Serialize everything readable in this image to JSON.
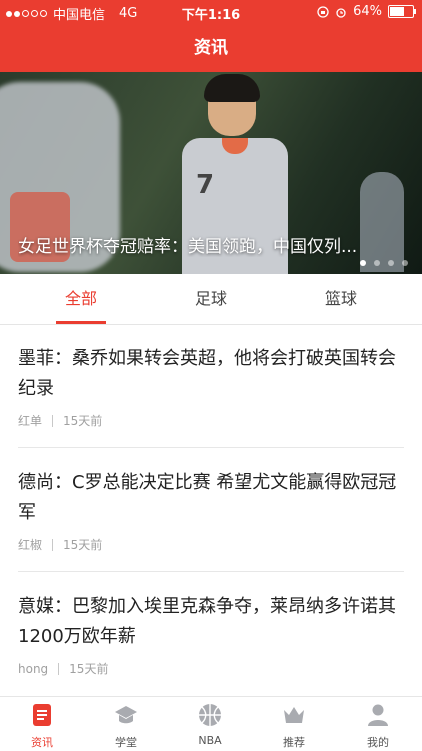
{
  "status_bar": {
    "carrier": "中国电信",
    "network": "4G",
    "time": "下午1:16",
    "battery": "64%"
  },
  "nav": {
    "title": "资讯"
  },
  "banner": {
    "caption": "女足世界杯夺冠赔率：美国领跑，中国仅列...",
    "jersey_number": "7",
    "page_count": 4,
    "active_page": 1
  },
  "tabs": [
    {
      "label": "全部",
      "active": true
    },
    {
      "label": "足球",
      "active": false
    },
    {
      "label": "篮球",
      "active": false
    }
  ],
  "news": [
    {
      "title": "墨菲：桑乔如果转会英超，他将会打破英国转会纪录",
      "source": "红单",
      "time": "15天前"
    },
    {
      "title": "德尚：C罗总能决定比赛 希望尤文能赢得欧冠冠军",
      "source": "红椒",
      "time": "15天前"
    },
    {
      "title": "意媒：巴黎加入埃里克森争夺，莱昂纳多许诺其1200万欧年薪",
      "source": "hong",
      "time": "15天前"
    }
  ],
  "tabbar": [
    {
      "label": "资讯",
      "icon": "news-icon",
      "active": true
    },
    {
      "label": "学堂",
      "icon": "graduation-cap-icon",
      "active": false
    },
    {
      "label": "NBA",
      "icon": "basketball-icon",
      "active": false
    },
    {
      "label": "推荐",
      "icon": "crown-icon",
      "active": false
    },
    {
      "label": "我的",
      "icon": "user-icon",
      "active": false
    }
  ],
  "colors": {
    "accent": "#ea3d30",
    "tab_text": "#444444",
    "meta_text": "#a0a0a0"
  }
}
